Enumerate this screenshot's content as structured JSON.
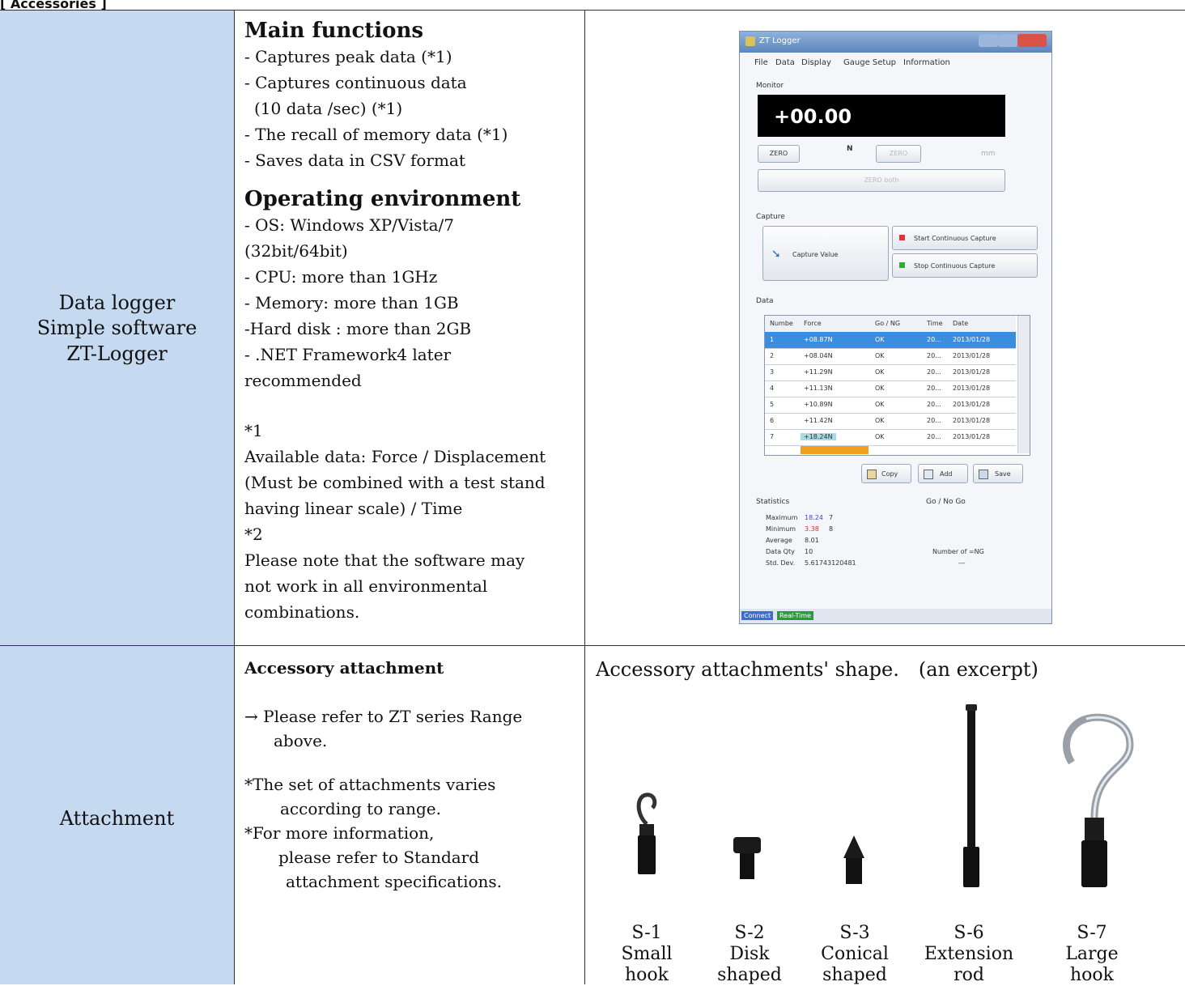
{
  "header_fragment": "[ Accessories ]",
  "row1": {
    "label_lines": [
      "Data logger",
      "Simple software",
      "ZT-Logger"
    ],
    "main_functions_title": "Main functions",
    "main_functions": [
      "- Captures peak data (*1)",
      "- Captures continuous data",
      "  (10 data /sec) (*1)",
      "- The recall of memory data (*1)",
      "- Saves data in CSV format"
    ],
    "operating_title": "Operating environment",
    "operating": [
      "- OS: Windows XP/Vista/7",
      "(32bit/64bit)",
      "- CPU: more than 1GHz",
      "- Memory: more than 1GB",
      "-Hard disk : more than 2GB",
      "- .NET Framework4 later",
      "recommended"
    ],
    "notes": [
      "*1",
      "Available data: Force / Displacement",
      "(Must be combined with a test stand",
      "having linear scale) / Time",
      "*2",
      "Please note that the software may",
      "not work in all environmental",
      "combinations."
    ]
  },
  "screenshot": {
    "window_title": "ZT Logger",
    "menu": [
      "File",
      "Data",
      "Display",
      "Gauge Setup",
      "Information"
    ],
    "monitor_label": "Monitor",
    "monitor_value": "+00.00",
    "unit": "N",
    "zero_button": "ZERO",
    "zero_button_disabled": "ZERO",
    "unit_right": "mm",
    "zero_both": "ZERO both",
    "capture_label": "Capture",
    "capture_value_button": "Capture Value",
    "start_continuous": "Start Continuous Capture",
    "stop_continuous": "Stop Continuous Capture",
    "data_label": "Data",
    "grid_headers": [
      "Numbe",
      "Force",
      "Go / NG",
      "Time",
      "Date"
    ],
    "grid_rows": [
      [
        "1",
        "+08.87N",
        "OK",
        "20...",
        "2013/01/28"
      ],
      [
        "2",
        "+08.04N",
        "OK",
        "20...",
        "2013/01/28"
      ],
      [
        "3",
        "+11.29N",
        "OK",
        "20...",
        "2013/01/28"
      ],
      [
        "4",
        "+11.13N",
        "OK",
        "20...",
        "2013/01/28"
      ],
      [
        "5",
        "+10.89N",
        "OK",
        "20...",
        "2013/01/28"
      ],
      [
        "6",
        "+11.42N",
        "OK",
        "20...",
        "2013/01/28"
      ],
      [
        "7",
        "+18.24N",
        "OK",
        "20...",
        "2013/01/28"
      ]
    ],
    "copy_button": "Copy",
    "add_button": "Add",
    "save_button": "Save",
    "statistics_label": "Statistics",
    "stats": [
      {
        "label": "Maximum",
        "value": "18.24",
        "count": "7"
      },
      {
        "label": "Minimum",
        "value": "3.38",
        "count": "8"
      },
      {
        "label": "Average",
        "value": "8.01",
        "count": ""
      },
      {
        "label": "Data Qty",
        "value": "10",
        "count": ""
      },
      {
        "label": "Std. Dev.",
        "value": "5.61743120481",
        "count": ""
      }
    ],
    "gonogo_label": "Go / No Go",
    "number_ng_label": "Number of =NG",
    "number_ng_value": "---",
    "status_connect": "Connect",
    "status_realtime": "Real-Time"
  },
  "row2": {
    "label": "Attachment",
    "accessory_title": "Accessory attachment",
    "lines": [
      "→ Please refer to ZT series Range",
      "above.",
      "*The set of attachments varies",
      "according to range.",
      "*For more information,",
      "please refer to Standard",
      "attachment specifications."
    ],
    "shapes_title": "Accessory attachments' shape.　(an excerpt)",
    "attachments": [
      {
        "code": "S-1",
        "name1": "Small",
        "name2": "hook"
      },
      {
        "code": "S-2",
        "name1": "Disk",
        "name2": "shaped"
      },
      {
        "code": "S-3",
        "name1": "Conical",
        "name2": "shaped"
      },
      {
        "code": "S-6",
        "name1": "Extension",
        "name2": "rod"
      },
      {
        "code": "S-7",
        "name1": "Large",
        "name2": "hook"
      }
    ]
  }
}
